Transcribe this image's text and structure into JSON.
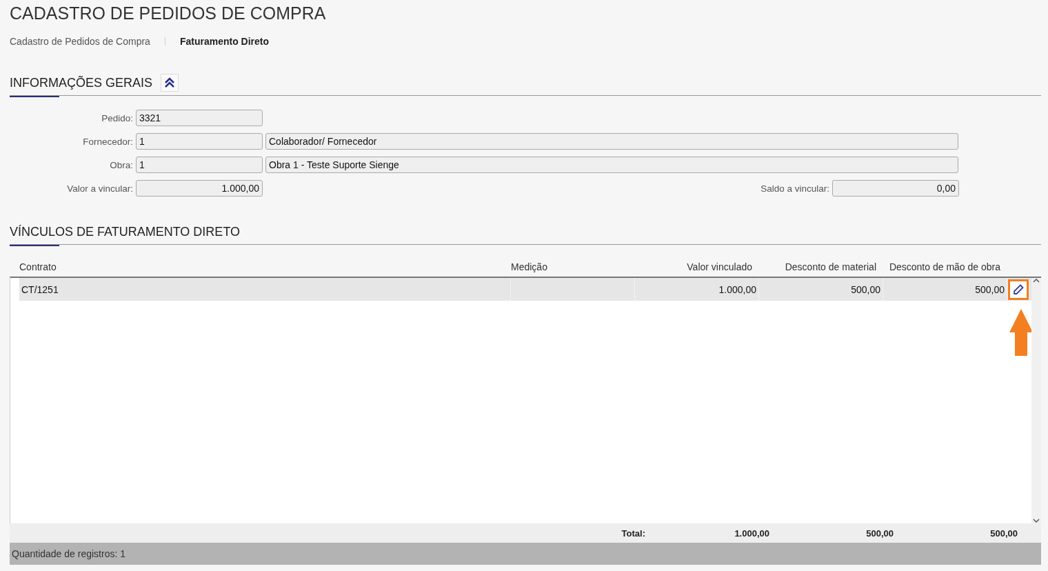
{
  "page_title": "CADASTRO DE PEDIDOS DE COMPRA",
  "breadcrumb": [
    {
      "label": "Cadastro de Pedidos de Compra",
      "selected": false
    },
    {
      "label": "Faturamento Direto",
      "selected": true
    }
  ],
  "general_section": {
    "title": "INFORMAÇÕES GERAIS",
    "expanded": true,
    "fields": [
      {
        "kind": "pair",
        "label": "Pedido:",
        "value": "3321"
      },
      {
        "kind": "pair",
        "label": "Fornecedor:",
        "value": "1",
        "description": "Colaborador/ Fornecedor"
      },
      {
        "kind": "pair",
        "label": "Obra:",
        "value": "1",
        "description": "Obra 1 - Teste Suporte Sienge"
      },
      {
        "kind": "split",
        "label": "Valor a vincular:",
        "value": "1.000,00",
        "right_label": "Saldo a vincular:",
        "right_value": "0,00"
      }
    ]
  },
  "links_section": {
    "title": "VÍNCULOS DE FATURAMENTO DIRETO",
    "table": {
      "columns": [
        "Contrato",
        "Medição",
        "Valor vinculado",
        "Desconto de material",
        "Desconto de mão de obra"
      ],
      "rows": [
        {
          "cells": [
            "CT/1251",
            "",
            "1.000,00",
            "500,00",
            "500,00"
          ],
          "highlighted": true
        }
      ],
      "totals": {
        "label": "Total:",
        "values": [
          "1.000,00",
          "500,00",
          "500,00"
        ]
      },
      "record_count": "Quantidade de registros: 1"
    }
  }
}
